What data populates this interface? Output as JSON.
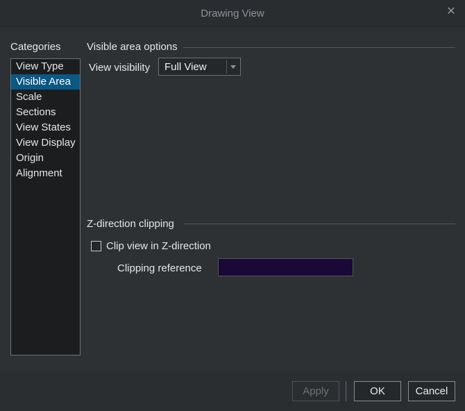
{
  "window": {
    "title": "Drawing View"
  },
  "categories": {
    "label": "Categories",
    "items": [
      {
        "label": "View Type",
        "selected": false
      },
      {
        "label": "Visible Area",
        "selected": true
      },
      {
        "label": "Scale",
        "selected": false
      },
      {
        "label": "Sections",
        "selected": false
      },
      {
        "label": "View States",
        "selected": false
      },
      {
        "label": "View Display",
        "selected": false
      },
      {
        "label": "Origin",
        "selected": false
      },
      {
        "label": "Alignment",
        "selected": false
      }
    ]
  },
  "visible_area": {
    "section_title": "Visible area options",
    "visibility_label": "View visibility",
    "visibility_value": "Full View"
  },
  "z_clipping": {
    "section_title": "Z-direction clipping",
    "clip_label": "Clip view in Z-direction",
    "clip_checked": false,
    "reference_label": "Clipping reference",
    "reference_value": ""
  },
  "buttons": {
    "apply": "Apply",
    "ok": "OK",
    "cancel": "Cancel"
  },
  "colors": {
    "selection": "#0b5884",
    "reference_box": "#190838"
  },
  "icons": {
    "close": "close-icon",
    "dropdown": "chevron-down-icon"
  }
}
